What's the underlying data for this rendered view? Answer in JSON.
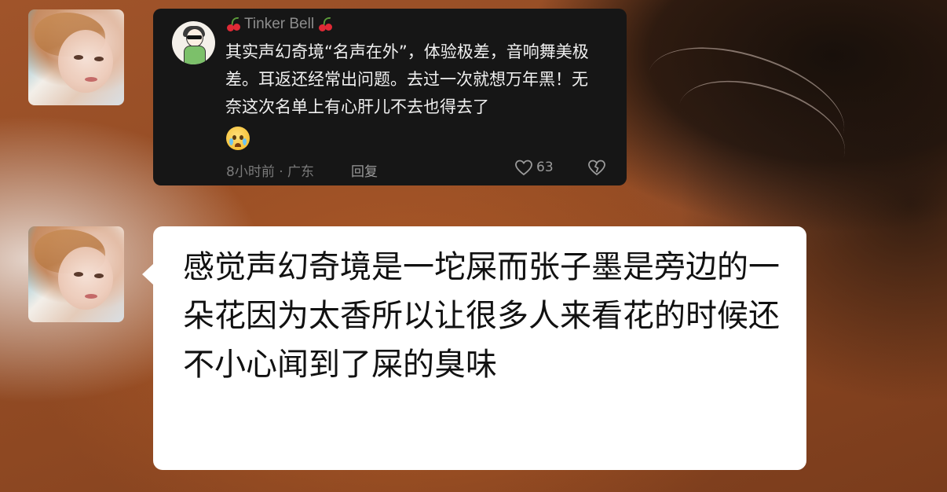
{
  "comment": {
    "username": "Tinker Bell",
    "text": "其实声幻奇境“名声在外”，体验极差，音响舞美极差。耳返还经常出问题。去过一次就想万年黑！无奈这次名单上有心肝儿不去也得去了",
    "emoji": "crying-face-emoji",
    "meta": "8小时前 · 广东",
    "reply_label": "回复",
    "like_count": "63",
    "icons": [
      "cherry-icon",
      "heart-icon",
      "broken-heart-icon"
    ]
  },
  "message": {
    "text": "感觉声幻奇境是一坨屎而张子墨是旁边的一朵花因为太香所以让很多人来看花的时候还不小心闻到了屎的臭味"
  },
  "colors": {
    "card_bg": "#161616",
    "bubble_bg": "#ffffff",
    "muted_text": "#7a7a7a"
  }
}
